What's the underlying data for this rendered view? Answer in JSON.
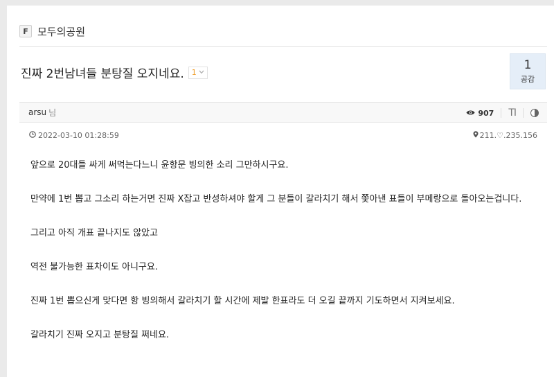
{
  "board": {
    "icon_letter": "F",
    "name": "모두의공원"
  },
  "post": {
    "title": "진짜 2번남녀들 분탕질 오지네요.",
    "comment_count": "1",
    "like_count": "1",
    "like_label": "공감",
    "author": "arsu",
    "author_suffix": "님",
    "views": "907",
    "font_button": "TI",
    "date": "2022-03-10 01:28:59",
    "ip": "211.♡.235.156",
    "paragraphs": [
      "앞으로 20대들 싸게 써먹는다느니 윤항문 빙의한 소리 그만하시구요.",
      "만약에 1번 뽑고 그소리 하는거면 진짜 X잡고 반성하셔야 할게 그 분들이 갈라치기 해서 쫓아낸 표들이 부메랑으로 돌아오는겁니다.",
      "그리고 아직 개표 끝나지도 않았고",
      "역전 불가능한 표차이도 아니구요.",
      "진짜 1번 뽑으신게 맞다면 항 빙의해서 갈라치기 할 시간에 제발 한표라도 더 오길 끝까지 기도하면서 지켜보세요.",
      "갈라치기 진짜 오지고 분탕질 쩌네요."
    ]
  },
  "icons": {
    "views": "eye-icon",
    "date": "clock-icon",
    "ip": "location-pin-icon",
    "font": "font-size-icon",
    "contrast": "contrast-icon",
    "dropdown": "chevron-down-icon"
  }
}
